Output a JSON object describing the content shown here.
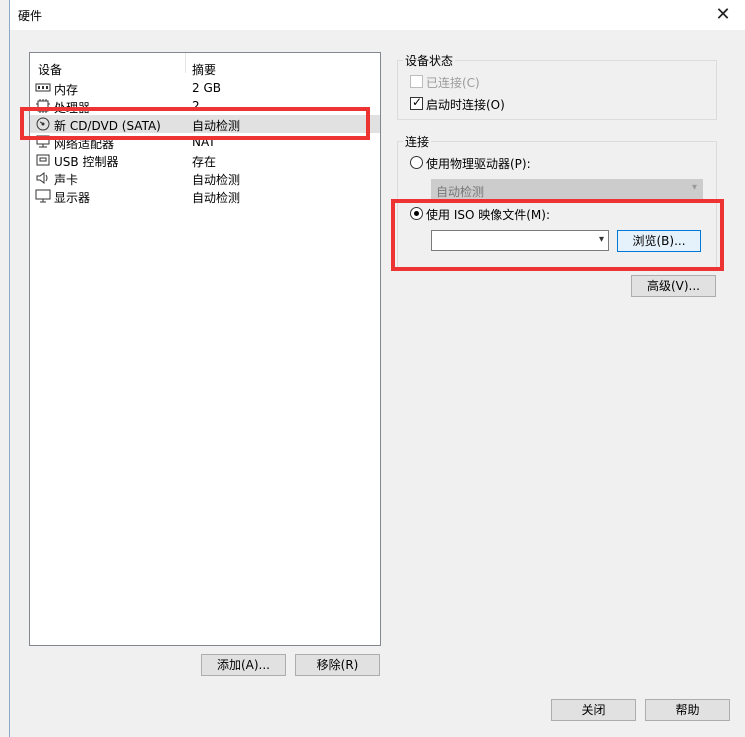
{
  "window": {
    "title": "硬件",
    "close_glyph": "✕"
  },
  "device_list": {
    "headers": {
      "device": "设备",
      "summary": "摘要"
    },
    "rows": [
      {
        "icon": "memory-icon",
        "name": "内存",
        "summary": "2 GB"
      },
      {
        "icon": "processor-icon",
        "name": "处理器",
        "summary": "2"
      },
      {
        "icon": "cd-dvd-icon",
        "name": "新 CD/DVD (SATA)",
        "summary": "自动检测",
        "selected": true
      },
      {
        "icon": "network-adapter-icon",
        "name": "网络适配器",
        "summary": "NAT"
      },
      {
        "icon": "usb-controller-icon",
        "name": "USB 控制器",
        "summary": "存在"
      },
      {
        "icon": "sound-card-icon",
        "name": "声卡",
        "summary": "自动检测"
      },
      {
        "icon": "display-icon",
        "name": "显示器",
        "summary": "自动检测"
      }
    ]
  },
  "buttons": {
    "add": "添加(A)...",
    "remove": "移除(R)",
    "close": "关闭",
    "help": "帮助"
  },
  "device_status": {
    "label": "设备状态",
    "connected": {
      "label": "已连接(C)",
      "checked": false,
      "disabled": true
    },
    "connect_at_power_on": {
      "label": "启动时连接(O)",
      "checked": true
    }
  },
  "connection": {
    "label": "连接",
    "physical_drive": {
      "label": "使用物理驱动器(P):",
      "selected": false,
      "value": "自动检测"
    },
    "iso_image": {
      "label": "使用 ISO 映像文件(M):",
      "selected": true,
      "value": "",
      "browse": "浏览(B)..."
    },
    "advanced": "高级(V)..."
  },
  "colors": {
    "highlight": "#ee3333",
    "selection": "#e1e1e1",
    "focus_border": "#0078d7"
  }
}
